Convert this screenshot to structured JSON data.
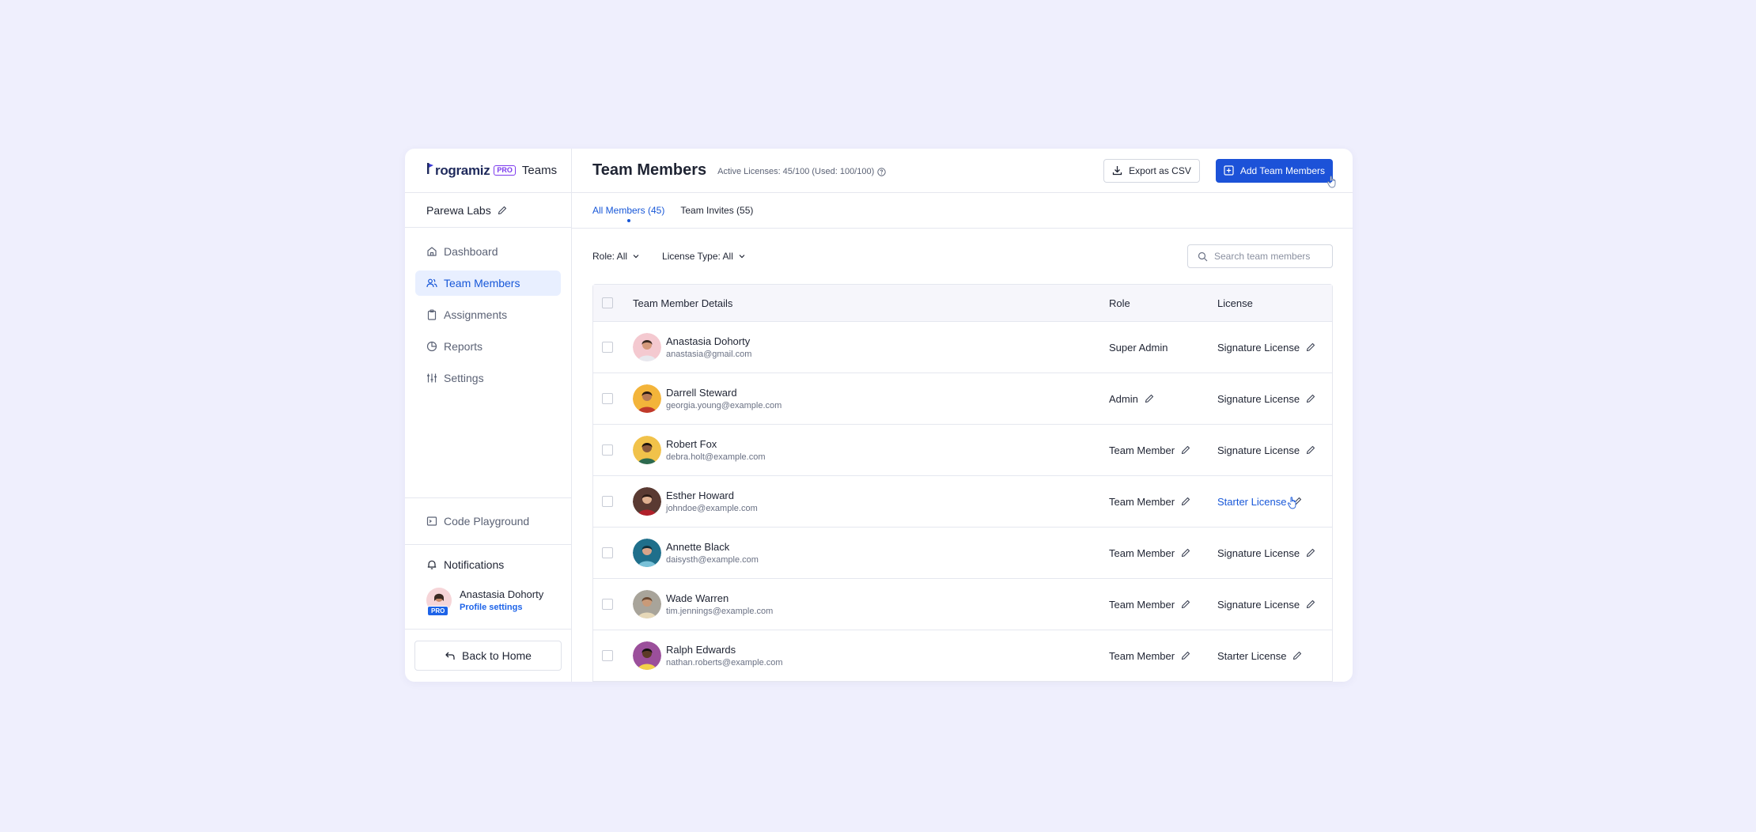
{
  "brand": {
    "logo": "rogramiz",
    "pro": "PRO",
    "product": "Teams"
  },
  "org": {
    "name": "Parewa Labs"
  },
  "sidebar": {
    "items": [
      {
        "label": "Dashboard",
        "icon": "home-icon",
        "active": false
      },
      {
        "label": "Team Members",
        "icon": "users-icon",
        "active": true
      },
      {
        "label": "Assignments",
        "icon": "clipboard-icon",
        "active": false
      },
      {
        "label": "Reports",
        "icon": "pie-chart-icon",
        "active": false
      },
      {
        "label": "Settings",
        "icon": "sliders-icon",
        "active": false
      }
    ],
    "code_playground": "Code Playground",
    "notifications": "Notifications",
    "profile": {
      "name": "Anastasia Dohorty",
      "link": "Profile settings",
      "badge": "PRO"
    },
    "back": "Back to Home"
  },
  "header": {
    "title": "Team Members",
    "licenses": "Active Licenses: 45/100 (Used: 100/100)",
    "export": "Export as CSV",
    "add": "Add Team Members"
  },
  "tabs": [
    {
      "label": "All Members (45)",
      "active": true
    },
    {
      "label": "Team Invites (55)",
      "active": false
    }
  ],
  "filters": {
    "role": "Role: All",
    "license": "License Type: All",
    "search_placeholder": "Search team members"
  },
  "table": {
    "headers": {
      "details": "Team Member Details",
      "role": "Role",
      "license": "License"
    },
    "rows": [
      {
        "name": "Anastasia Dohorty",
        "email": "anastasia@gmail.com",
        "role": "Super Admin",
        "role_editable": false,
        "license": "Signature License",
        "highlight": false
      },
      {
        "name": "Darrell Steward",
        "email": "georgia.young@example.com",
        "role": "Admin",
        "role_editable": true,
        "license": "Signature License",
        "highlight": false
      },
      {
        "name": "Robert Fox",
        "email": "debra.holt@example.com",
        "role": "Team Member",
        "role_editable": true,
        "license": "Signature License",
        "highlight": false
      },
      {
        "name": "Esther Howard",
        "email": "johndoe@example.com",
        "role": "Team Member",
        "role_editable": true,
        "license": "Starter License",
        "highlight": true
      },
      {
        "name": "Annette Black",
        "email": "daisysth@example.com",
        "role": "Team Member",
        "role_editable": true,
        "license": "Signature License",
        "highlight": false
      },
      {
        "name": "Wade Warren",
        "email": "tim.jennings@example.com",
        "role": "Team Member",
        "role_editable": true,
        "license": "Signature License",
        "highlight": false
      },
      {
        "name": "Ralph Edwards",
        "email": "nathan.roberts@example.com",
        "role": "Team Member",
        "role_editable": true,
        "license": "Starter License",
        "highlight": false
      }
    ]
  },
  "colors": {
    "accent": "#1c52d8",
    "active_bg": "#e8efff",
    "page_bg": "#efeffd",
    "pro": "#7c3aed"
  }
}
